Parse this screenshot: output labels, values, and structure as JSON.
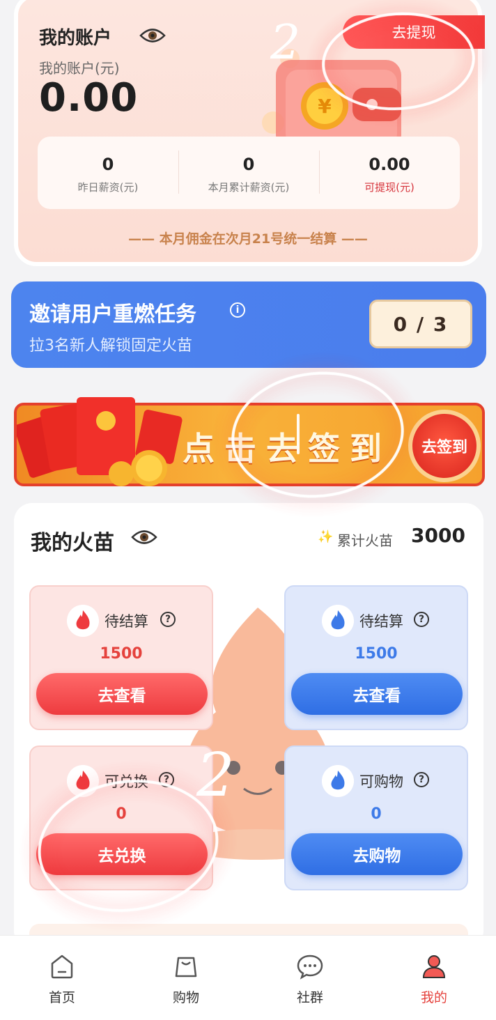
{
  "account": {
    "title": "我的账户",
    "subtitle": "我的账户(元)",
    "amount": "0.00",
    "withdraw_label": "去提现",
    "stats": [
      {
        "value": "0",
        "label": "昨日薪资(元)"
      },
      {
        "value": "0",
        "label": "本月累计薪资(元)"
      },
      {
        "value": "0.00",
        "label": "可提现(元)"
      }
    ],
    "settle_note": "—— 本月佣金在次月21号统一结算 ——"
  },
  "invite": {
    "title": "邀请用户重燃任务",
    "subtitle": "拉3名新人解锁固定火苗",
    "progress": "0 / 3"
  },
  "signin": {
    "banner_text": "点击去签到",
    "button_label": "去签到"
  },
  "sprout": {
    "title": "我的火苗",
    "total_label": "累计火苗",
    "total_value": "3000",
    "tiles": [
      {
        "label": "待结算",
        "value": "1500",
        "button": "去查看"
      },
      {
        "label": "待结算",
        "value": "1500",
        "button": "去查看"
      },
      {
        "label": "可兑换",
        "value": "0",
        "button": "去兑换"
      },
      {
        "label": "可购物",
        "value": "0",
        "button": "去购物"
      }
    ]
  },
  "nav": {
    "items": [
      {
        "label": "首页"
      },
      {
        "label": "购物"
      },
      {
        "label": "社群"
      },
      {
        "label": "我的"
      }
    ]
  },
  "annotations": {
    "mark_top": "2",
    "mark_bottom": "2"
  },
  "colors": {
    "accent_red": "#e5423d",
    "accent_blue": "#3d7ae8",
    "invite_blue": "#4a7ded"
  }
}
